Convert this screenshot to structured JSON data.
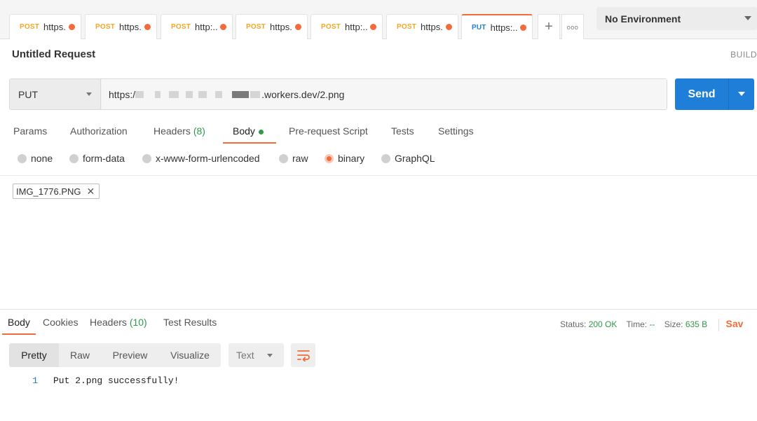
{
  "tabs": [
    {
      "method": "POST",
      "name": "https..."
    },
    {
      "method": "POST",
      "name": "https..."
    },
    {
      "method": "POST",
      "name": "http:..."
    },
    {
      "method": "POST",
      "name": "https..."
    },
    {
      "method": "POST",
      "name": "http:..."
    },
    {
      "method": "POST",
      "name": "https..."
    },
    {
      "method": "PUT",
      "name": "https:..."
    }
  ],
  "tab_actions": {
    "add": "+",
    "more": "ooo"
  },
  "environment": {
    "selected": "No Environment"
  },
  "request": {
    "title": "Untitled Request",
    "build_label": "BUILD",
    "method": "PUT",
    "url_prefix": "https:/",
    "url_suffix": ".workers.dev/2.png",
    "send_label": "Send"
  },
  "request_tabs": {
    "params": "Params",
    "authorization": "Authorization",
    "headers": "Headers",
    "headers_count": "(8)",
    "body": "Body",
    "prerequest": "Pre-request Script",
    "tests": "Tests",
    "settings": "Settings"
  },
  "body_modes": {
    "none": "none",
    "form_data": "form-data",
    "urlencoded": "x-www-form-urlencoded",
    "raw": "raw",
    "binary": "binary",
    "graphql": "GraphQL",
    "selected": "binary"
  },
  "file": {
    "name": "IMG_1776.PNG",
    "remove": "✕"
  },
  "response_tabs": {
    "body": "Body",
    "cookies": "Cookies",
    "headers": "Headers",
    "headers_count": "(10)",
    "test_results": "Test Results"
  },
  "response_status": {
    "status_label": "Status:",
    "status_value": "200 OK",
    "time_label": "Time:",
    "time_value": "--",
    "size_label": "Size:",
    "size_value": "635 B",
    "save_label": "Sav"
  },
  "response_views": {
    "pretty": "Pretty",
    "raw": "Raw",
    "preview": "Preview",
    "visualize": "Visualize",
    "format": "Text"
  },
  "response_body": {
    "lines": [
      {
        "number": "1",
        "text": "Put 2.png successfully!"
      }
    ]
  },
  "colors": {
    "accent": "#f26b3a",
    "send": "#1f7fd8",
    "ok": "#2e9a48",
    "post": "#f5a623",
    "put": "#1f7fd8"
  }
}
